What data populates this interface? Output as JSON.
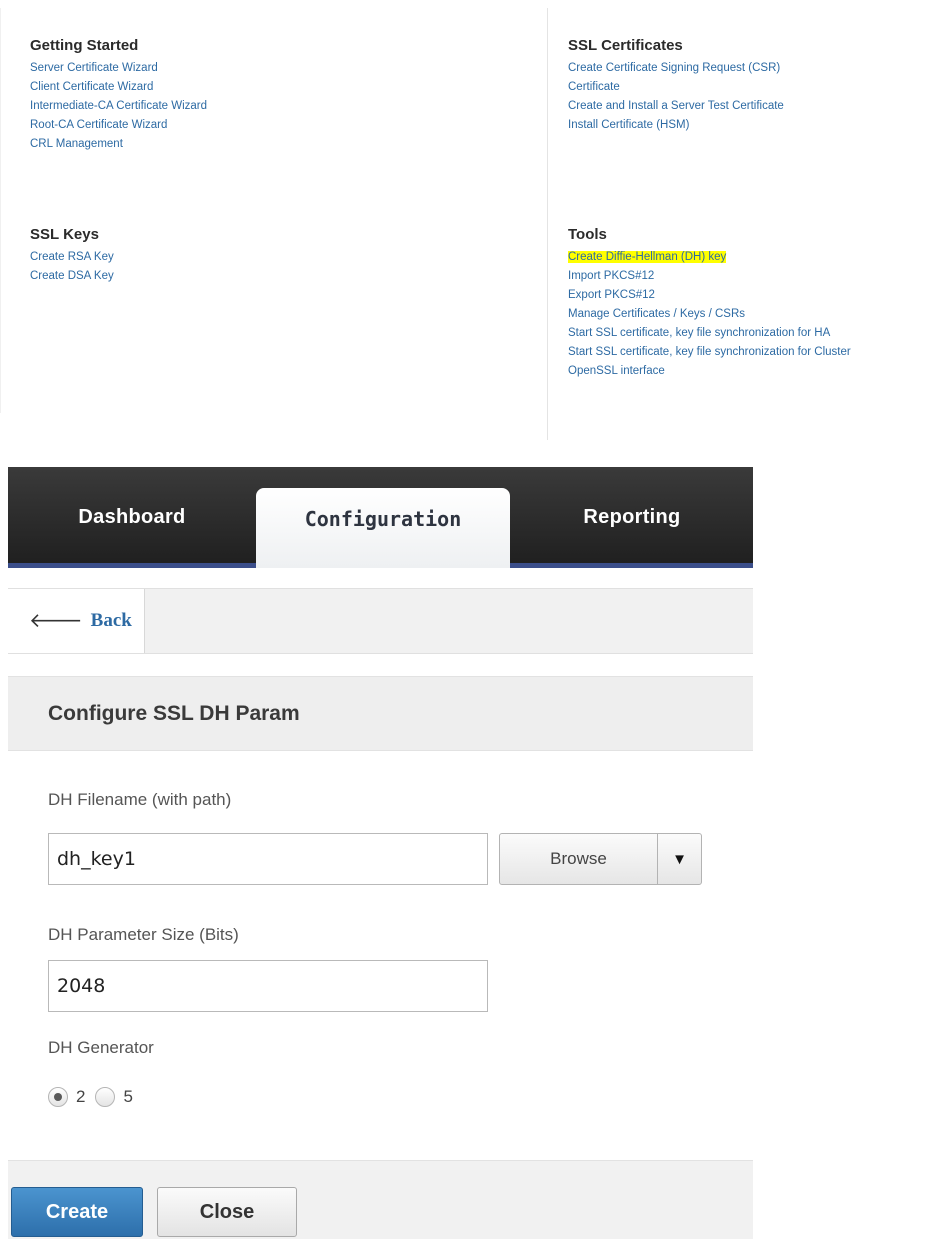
{
  "utilities": {
    "getting_started": {
      "title": "Getting Started",
      "links": [
        "Server Certificate Wizard",
        "Client Certificate Wizard",
        "Intermediate-CA Certificate Wizard",
        "Root-CA Certificate Wizard",
        "CRL Management"
      ]
    },
    "ssl_keys": {
      "title": "SSL Keys",
      "links": [
        "Create RSA Key",
        "Create DSA Key"
      ]
    },
    "ssl_certificates": {
      "title": "SSL Certificates",
      "links": [
        "Create Certificate Signing Request (CSR)",
        "Certificate",
        "Create and Install a Server Test Certificate",
        "Install Certificate (HSM)"
      ]
    },
    "tools": {
      "title": "Tools",
      "links": [
        "Create Diffie-Hellman (DH) key",
        "Import PKCS#12",
        "Export PKCS#12",
        "Manage Certificates / Keys / CSRs",
        "Start SSL certificate, key file synchronization for HA",
        "Start SSL certificate, key file synchronization for Cluster",
        "OpenSSL interface"
      ],
      "highlight_color": "#ffff00"
    }
  },
  "tabs": {
    "dashboard": "Dashboard",
    "configuration": "Configuration",
    "reporting": "Reporting"
  },
  "back": {
    "label": "Back",
    "icon": "left-arrow-icon"
  },
  "dialog": {
    "title": "Configure SSL DH Param",
    "filename_label": "DH Filename (with path)",
    "filename_value": "dh_key1",
    "browse_label": "Browse",
    "size_label": "DH Parameter Size (Bits)",
    "size_value": "2048",
    "generator_label": "DH Generator",
    "generator_options": [
      "2",
      "5"
    ],
    "generator_selected": "2",
    "create_label": "Create",
    "close_label": "Close"
  },
  "colors": {
    "link": "#2d6aa3",
    "primary_button": "#2d6fab",
    "tab_bar": "#2a2a2a",
    "tab_accent": "#3b4e8a"
  }
}
